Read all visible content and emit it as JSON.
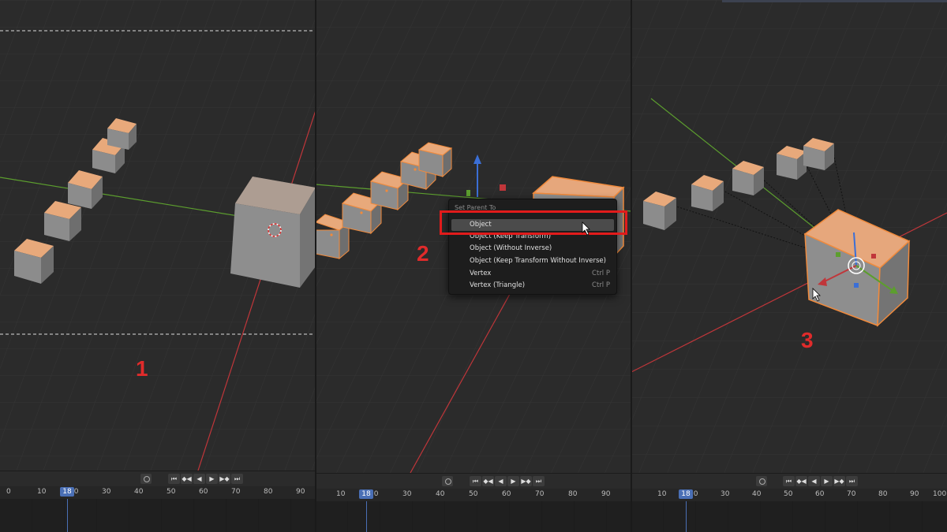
{
  "steps": {
    "one": "1",
    "two": "2",
    "three": "3"
  },
  "context_menu": {
    "title": "Set Parent To",
    "items": [
      {
        "label": "Object",
        "shortcut": ""
      },
      {
        "label": "Object (Keep Transform)",
        "shortcut": ""
      },
      {
        "label": "Object (Without Inverse)",
        "shortcut": ""
      },
      {
        "label": "Object (Keep Transform Without Inverse)",
        "shortcut": ""
      },
      {
        "label": "Vertex",
        "shortcut": "Ctrl P"
      },
      {
        "label": "Vertex (Triangle)",
        "shortcut": "Ctrl P"
      }
    ]
  },
  "timeline": {
    "current_frame": "18",
    "panel1_ticks": [
      "0",
      "10",
      "20",
      "30",
      "40",
      "50",
      "60",
      "70",
      "80",
      "90"
    ],
    "panel2_ticks": [
      "10",
      "20",
      "30",
      "40",
      "50",
      "60",
      "70",
      "80",
      "90"
    ],
    "panel3_ticks": [
      "10",
      "20",
      "30",
      "40",
      "50",
      "60",
      "70",
      "80",
      "90",
      "100"
    ]
  },
  "playback": {
    "jump_start": "⏮",
    "prev_key": "◆◀",
    "play_reverse": "◀",
    "play": "▶",
    "next_key": "▶◆",
    "jump_end": "⏭"
  },
  "colors": {
    "highlight_box": "#e11b1b",
    "selection_outline": "#f08a3c",
    "cursor_frame": "#4a6fb5",
    "x_axis": "#c0363a",
    "y_axis": "#5c9e2e"
  }
}
